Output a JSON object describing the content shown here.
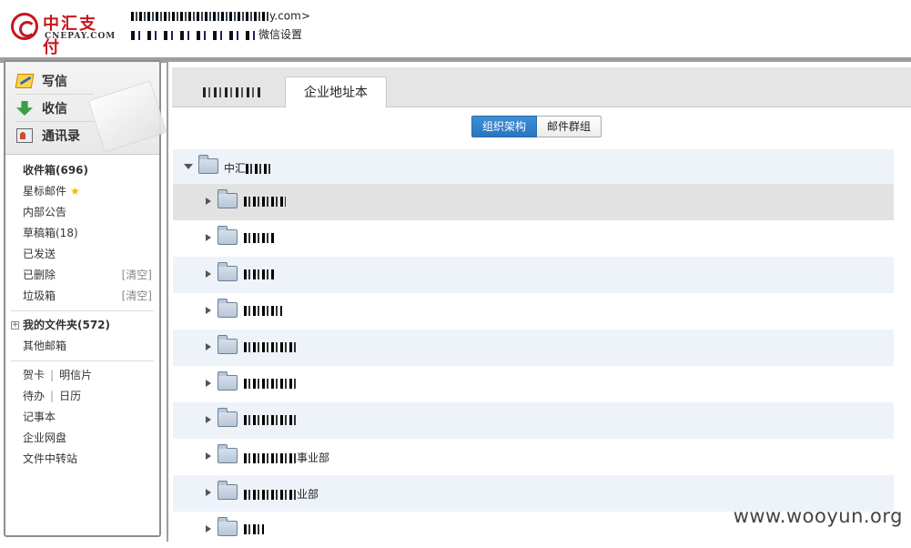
{
  "header": {
    "logo_text": "中汇支付",
    "logo_domain": "CNEPAY.COM",
    "account_suffix": "y.com>",
    "settings_link": "微信设置"
  },
  "sidebar": {
    "compose": [
      {
        "label": "写信",
        "icon": "pencil-paper-icon"
      },
      {
        "label": "收信",
        "icon": "download-arrow-icon"
      },
      {
        "label": "通讯录",
        "icon": "contact-card-icon"
      }
    ],
    "folders": [
      {
        "label": "收件箱(696)",
        "bold": true
      },
      {
        "label": "星标邮件",
        "star": "★"
      },
      {
        "label": "内部公告"
      },
      {
        "label": "草稿箱(18)"
      },
      {
        "label": "已发送"
      },
      {
        "label": "已删除",
        "action": "[清空]"
      },
      {
        "label": "垃圾箱",
        "action": "[清空]"
      }
    ],
    "my_folders": {
      "expand": "+",
      "label": "我的文件夹(572)"
    },
    "other_mailbox": "其他邮箱",
    "tools": {
      "card": "贺卡",
      "postcard": "明信片",
      "todo": "待办",
      "calendar": "日历",
      "notes": "记事本",
      "disk": "企业网盘",
      "transfer": "文件中转站",
      "separator": "|"
    }
  },
  "main": {
    "tabs": [
      {
        "label": "",
        "active": false
      },
      {
        "label": "企业地址本",
        "active": true
      }
    ],
    "toggle": {
      "org": "组织架构",
      "groups": "邮件群组"
    },
    "tree": {
      "root_label": "中汇",
      "nodes": [
        {
          "label": "",
          "suffix": ""
        },
        {
          "label": "",
          "suffix": ""
        },
        {
          "label": "",
          "suffix": ""
        },
        {
          "label": "",
          "suffix": ""
        },
        {
          "label": "",
          "suffix": ""
        },
        {
          "label": "",
          "suffix": ""
        },
        {
          "label": "",
          "suffix": ""
        },
        {
          "label": "",
          "suffix": "事业部"
        },
        {
          "label": "",
          "suffix": "业部"
        },
        {
          "label": "",
          "suffix": ""
        }
      ]
    }
  },
  "watermark": "www.wooyun.org"
}
